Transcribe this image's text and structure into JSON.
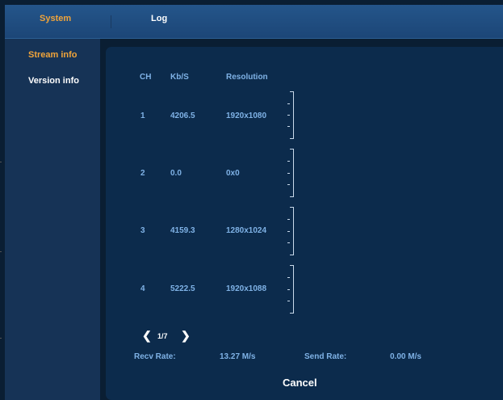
{
  "colors": {
    "accent": "#f0a43a",
    "value_text": "#7fb2e6",
    "header_bar": "#1c4677",
    "panel": "#0c2b4c",
    "sidebar": "#163356"
  },
  "tabs": [
    {
      "label": "System",
      "active": true
    },
    {
      "label": "Log",
      "active": false
    }
  ],
  "sidebar": {
    "items": [
      {
        "label": "Stream info",
        "active": true
      },
      {
        "label": "Version info",
        "active": false
      }
    ]
  },
  "table": {
    "columns": [
      "CH",
      "Kb/S",
      "Resolution"
    ],
    "rows": [
      {
        "ch": "1",
        "kbps": "4206.5",
        "resolution": "1920x1080"
      },
      {
        "ch": "2",
        "kbps": "0.0",
        "resolution": "0x0"
      },
      {
        "ch": "3",
        "kbps": "4159.3",
        "resolution": "1280x1024"
      },
      {
        "ch": "4",
        "kbps": "5222.5",
        "resolution": "1920x1088"
      }
    ]
  },
  "pager": {
    "prev_icon": "chevron-left-icon",
    "text": "1/7",
    "next_icon": "chevron-right-icon"
  },
  "rates": {
    "recv_label": "Recv Rate:",
    "recv_value": "13.27 M/s",
    "send_label": "Send Rate:",
    "send_value": "0.00 M/s"
  },
  "cancel_label": "Cancel"
}
